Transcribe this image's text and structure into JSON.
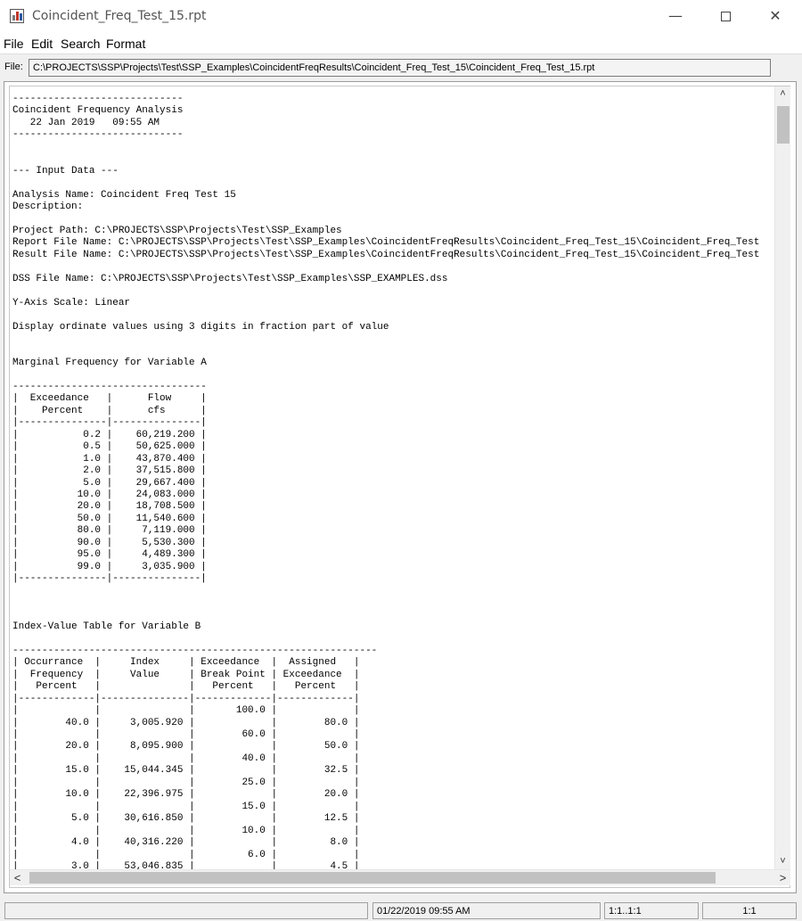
{
  "window": {
    "title": "Coincident_Freq_Test_15.rpt",
    "icon": "chart-icon",
    "minimize_glyph": "—",
    "close_glyph": "✕"
  },
  "menu": {
    "items": [
      "File",
      "Edit",
      "Search",
      "Format"
    ]
  },
  "file_bar": {
    "label": "File:",
    "path": "C:\\PROJECTS\\SSP\\Projects\\Test\\SSP_Examples\\CoincidentFreqResults\\Coincident_Freq_Test_15\\Coincident_Freq_Test_15.rpt"
  },
  "report": {
    "lines": [
      "-----------------------------",
      "Coincident Frequency Analysis",
      "   22 Jan 2019   09:55 AM",
      "-----------------------------",
      "",
      "",
      "--- Input Data ---",
      "",
      "Analysis Name: Coincident Freq Test 15",
      "Description:",
      "",
      "Project Path: C:\\PROJECTS\\SSP\\Projects\\Test\\SSP_Examples",
      "Report File Name: C:\\PROJECTS\\SSP\\Projects\\Test\\SSP_Examples\\CoincidentFreqResults\\Coincident_Freq_Test_15\\Coincident_Freq_Test",
      "Result File Name: C:\\PROJECTS\\SSP\\Projects\\Test\\SSP_Examples\\CoincidentFreqResults\\Coincident_Freq_Test_15\\Coincident_Freq_Test",
      "",
      "DSS File Name: C:\\PROJECTS\\SSP\\Projects\\Test\\SSP_Examples\\SSP_EXAMPLES.dss",
      "",
      "Y-Axis Scale: Linear",
      "",
      "Display ordinate values using 3 digits in fraction part of value",
      "",
      "",
      "Marginal Frequency for Variable A",
      "",
      "---------------------------------",
      "|  Exceedance   |      Flow     |",
      "|    Percent    |      cfs      |",
      "|---------------|---------------|",
      "|           0.2 |    60,219.200 |",
      "|           0.5 |    50,625.000 |",
      "|           1.0 |    43,870.400 |",
      "|           2.0 |    37,515.800 |",
      "|           5.0 |    29,667.400 |",
      "|          10.0 |    24,083.000 |",
      "|          20.0 |    18,708.500 |",
      "|          50.0 |    11,540.600 |",
      "|          80.0 |     7,119.000 |",
      "|          90.0 |     5,530.300 |",
      "|          95.0 |     4,489.300 |",
      "|          99.0 |     3,035.900 |",
      "|---------------|---------------|",
      "",
      "",
      "",
      "Index-Value Table for Variable B",
      "",
      "--------------------------------------------------------------",
      "| Occurrance  |     Index     | Exceedance  |  Assigned   |",
      "|  Frequency  |     Value     | Break Point | Exceedance  |",
      "|   Percent   |               |   Percent   |   Percent   |",
      "|-------------|---------------|-------------|-------------|",
      "|             |               |       100.0 |             |",
      "|        40.0 |     3,005.920 |             |        80.0 |",
      "|             |               |        60.0 |             |",
      "|        20.0 |     8,095.900 |             |        50.0 |",
      "|             |               |        40.0 |             |",
      "|        15.0 |    15,044.345 |             |        32.5 |",
      "|             |               |        25.0 |             |",
      "|        10.0 |    22,396.975 |             |        20.0 |",
      "|             |               |        15.0 |             |",
      "|         5.0 |    30,616.850 |             |        12.5 |",
      "|             |               |        10.0 |             |",
      "|         4.0 |    40,316.220 |             |         8.0 |",
      "|             |               |         6.0 |             |",
      "|         3.0 |    53,046.835 |             |         4.5 |"
    ]
  },
  "scrollbars": {
    "up_glyph": "˄",
    "down_glyph": "˅",
    "left_glyph": "<",
    "right_glyph": ">"
  },
  "status": {
    "cell1": "",
    "datetime": "01/22/2019 09:55 AM",
    "range": "1:1..1:1",
    "position": "1:1"
  }
}
